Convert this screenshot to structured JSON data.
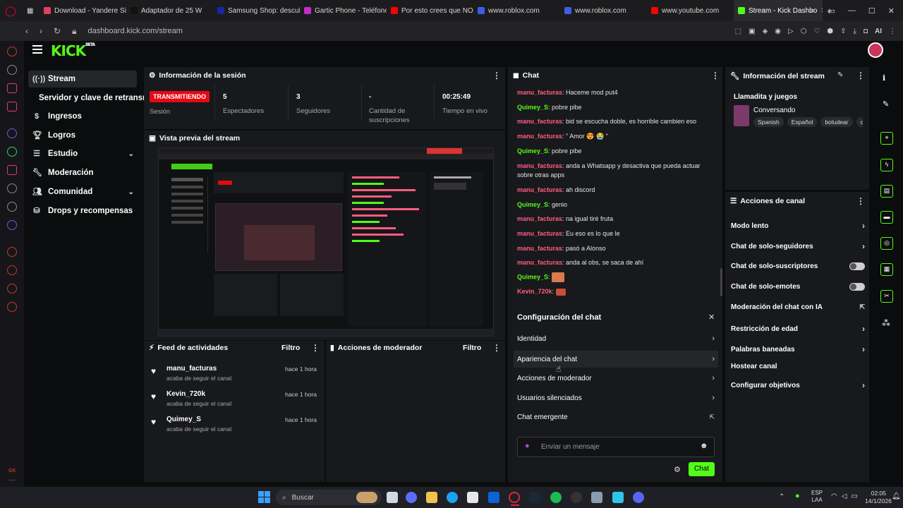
{
  "browser": {
    "tabs": [
      {
        "label": "Download - Yandere Sim",
        "color": "#e0405a"
      },
      {
        "label": "Adaptador de 25 W",
        "color": "#1b1b1b"
      },
      {
        "label": "Samsung Shop: descubr",
        "color": "#1428a0"
      },
      {
        "label": "Gartic Phone - Teléfono",
        "color": "#c42bd0"
      },
      {
        "label": "Por esto crees que NO l",
        "color": "#ff0000"
      },
      {
        "label": "www.roblox.com",
        "color": "#3b5ee8"
      },
      {
        "label": "www.roblox.com",
        "color": "#3b5ee8"
      },
      {
        "label": "www.youtube.com",
        "color": "#ff0000"
      },
      {
        "label": "Stream - Kick Dashbo",
        "color": "#53fc18"
      }
    ],
    "url": "dashboard.kick.com/stream",
    "ai_label": "AI"
  },
  "kick": {
    "logo": "KICK",
    "logo_sup": "BETA",
    "nav": {
      "stream": "Stream",
      "servidor": "Servidor y clave de retransm",
      "ingresos": "Ingresos",
      "logros": "Logros",
      "estudio": "Estudio",
      "moderacion": "Moderación",
      "comunidad": "Comunidad",
      "drops": "Drops y recompensas"
    },
    "session": {
      "title": "Información de la sesión",
      "live_badge": "TRANSMITIENDO",
      "live_label": "Sesión",
      "viewers_value": "5",
      "viewers_label": "Espectadores",
      "followers_value": "3",
      "followers_label": "Seguidores",
      "subs_value": "-",
      "subs_label": "Cantidad de suscripciones",
      "time_value": "00:25:49",
      "time_label": "Tiempo en vivo"
    },
    "preview": {
      "title": "Vista previa del stream"
    },
    "activity": {
      "title": "Feed de actividades",
      "filter": "Filtro",
      "items": [
        {
          "name": "manu_facturas",
          "sub": "acaba de seguir el canal",
          "time": "hace 1 hora"
        },
        {
          "name": "Kevin_720k",
          "sub": "acaba de seguir el canal",
          "time": "hace 1 hora"
        },
        {
          "name": "Quimey_S",
          "sub": "acaba de seguir el canal",
          "time": "hace 1 hora"
        }
      ]
    },
    "modactions": {
      "title": "Acciones de moderador",
      "filter": "Filtro"
    },
    "chat": {
      "title": "Chat",
      "messages": [
        {
          "user": "manu_facturas",
          "text": ": Haceme mod put4"
        },
        {
          "user": "Quimey_S",
          "text": ": pobre pibe"
        },
        {
          "user": "manu_facturas",
          "text": ": bid se escucha doble, es horrible cambien eso"
        },
        {
          "user": "manu_facturas",
          "text": ": \" Amor 😍 😭 \""
        },
        {
          "user": "Quimey_S",
          "text": ": pobre pibe"
        },
        {
          "user": "manu_facturas",
          "text": ": anda a Whatsapp y desactiva que pueda actuar sobre otras apps"
        },
        {
          "user": "manu_facturas",
          "text": ": ah discord"
        },
        {
          "user": "Quimey_S",
          "text": ": genio"
        },
        {
          "user": "manu_facturas",
          "text": ": na igual tiré fruta"
        },
        {
          "user": "manu_facturas",
          "text": ": Eu eso es lo que le"
        },
        {
          "user": "manu_facturas",
          "text": ": pasó a Alonso"
        },
        {
          "user": "manu_facturas",
          "text": ": anda al obs, se saca de ahí"
        },
        {
          "user": "Quimey_S",
          "text": ":"
        },
        {
          "user": "Kevin_720k",
          "text": ":"
        }
      ],
      "config_title": "Configuración del chat",
      "config_items": [
        "Identidad",
        "Apariencia del chat",
        "Acciones de moderador",
        "Usuarios silenciados",
        "Chat emergente"
      ],
      "input_placeholder": "Enviar un mensaje",
      "send": "Chat"
    },
    "streaminfo": {
      "title": "Información del stream",
      "stream_title": "Llamadita y juegos",
      "category": "Conversando",
      "tags": [
        "Spanish",
        "Español",
        "boludear",
        "c"
      ]
    },
    "channel_actions": {
      "title": "Acciones de canal",
      "items": [
        {
          "label": "Modo lento",
          "kind": "arrow"
        },
        {
          "label": "Chat de solo-seguidores",
          "kind": "arrow"
        },
        {
          "label": "Chat de solo-suscriptores",
          "kind": "toggle"
        },
        {
          "label": "Chat de solo-emotes",
          "kind": "toggle"
        },
        {
          "label": "Moderación del chat con IA",
          "kind": "external"
        },
        {
          "label": "Restricción de edad",
          "kind": "arrow"
        },
        {
          "label": "Palabras baneadas",
          "kind": "arrow"
        },
        {
          "label": "Hostear canal",
          "kind": "none"
        },
        {
          "label": "Configurar objetivos",
          "kind": "arrow"
        }
      ]
    }
  },
  "taskbar": {
    "search": "Buscar",
    "lang1": "ESP",
    "lang2": "LAA",
    "time": "02:05",
    "date": "14/1/2026"
  },
  "colors": {
    "accent": "#53fc18",
    "live": "#e50914",
    "user_pink": "#ff5e7e"
  }
}
